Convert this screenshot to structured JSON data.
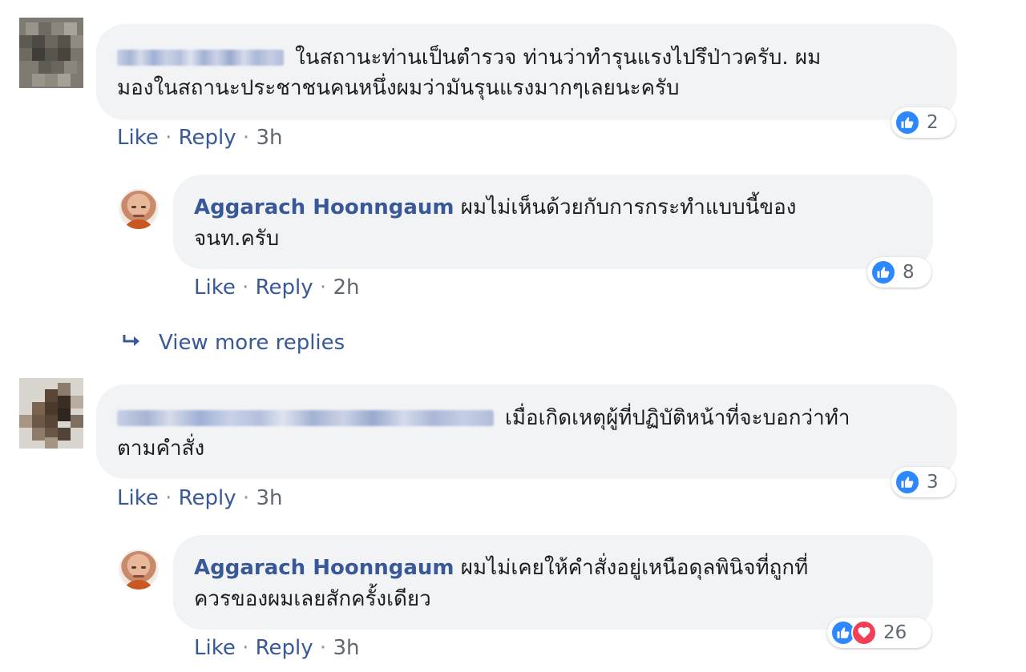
{
  "comments": [
    {
      "author_label": "",
      "text_line1": "ในสถานะท่านเป็นตำรวจ ท่านว่าทำรุนแรงไปรึป่าวครับ. ผม",
      "text_line2": "มองในสถานะประชาชนคนหนึ่งผมว่ามันรุนแรงมากๆเลยนะครับ",
      "actions": {
        "like": "Like",
        "reply": "Reply",
        "time": "3h"
      },
      "reactions": {
        "count": "2",
        "types": [
          "like-icon"
        ]
      },
      "reply": {
        "author": "Aggarach Hoonngaum",
        "text_line1": "ผมไม่เห็นด้วยกับการกระทำแบบนี้ของ",
        "text_line2": "จนท.ครับ",
        "actions": {
          "like": "Like",
          "reply": "Reply",
          "time": "2h"
        },
        "reactions": {
          "count": "8",
          "types": [
            "like-icon"
          ]
        }
      },
      "view_more_replies": "View more replies"
    },
    {
      "author_label": "",
      "text_line1": "เมื่อเกิดเหตุผู้ที่ปฏิบัติหน้าที่จะบอกว่าทำ",
      "text_line2": "ตามคำสั่ง",
      "actions": {
        "like": "Like",
        "reply": "Reply",
        "time": "3h"
      },
      "reactions": {
        "count": "3",
        "types": [
          "like-icon"
        ]
      },
      "reply": {
        "author": "Aggarach Hoonngaum",
        "text_line1": "ผมไม่เคยให้คำสั่งอยู่เหนือดุลพินิจที่ถูกที่",
        "text_line2": "ควรของผมเลยสักครั้งเดียว",
        "actions": {
          "like": "Like",
          "reply": "Reply",
          "time": "3h"
        },
        "reactions": {
          "count": "26",
          "types": [
            "like-icon",
            "love-icon"
          ]
        }
      }
    }
  ],
  "separator": "·",
  "colors": {
    "bubble": "#f2f3f5",
    "link": "#385898",
    "meta": "#606770",
    "like": "#2d88ff",
    "love": "#f33e58"
  }
}
